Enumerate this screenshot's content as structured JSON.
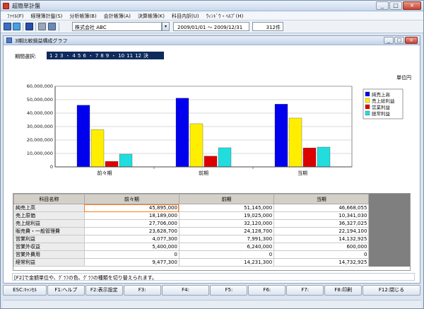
{
  "window": {
    "title": "超簡単計盤",
    "buttons": [
      "_",
      "□",
      "×"
    ]
  },
  "menu": {
    "items": [
      "ﾌｧｲﾙ(F)",
      "経理簿計盤(S)",
      "分析帳簿(B)",
      "会計帳簿(A)",
      "決算帳簿(K)",
      "科目内訳(U)",
      "ｳｨﾝﾄﾞｳ・ﾍﾙﾌﾟ(H)"
    ]
  },
  "toolbar": {
    "company": "株式会社 ABC",
    "period": "2009/01/01 〜 2009/12/31",
    "count": "312件",
    "dropdown_glyph": "▾"
  },
  "child_window": {
    "title": "3期比較損益構成グラフ",
    "buttons": [
      "_",
      "□",
      "×"
    ]
  },
  "period_select": {
    "label": "期間選択:",
    "months": [
      "1",
      "2",
      "3",
      "・",
      "4",
      "5",
      "6",
      "・",
      "7",
      "8",
      "9",
      "・",
      "10",
      "11",
      "12",
      "決"
    ]
  },
  "unit_label": "単位円",
  "chart_data": {
    "type": "bar",
    "categories": [
      "前々期",
      "前期",
      "当期"
    ],
    "series": [
      {
        "name": "純売上高",
        "color": "#0000ee",
        "values": [
          45895000,
          51145000,
          46668055
        ]
      },
      {
        "name": "売上総利益",
        "color": "#ffee00",
        "values": [
          27706000,
          32120000,
          36327025
        ]
      },
      {
        "name": "営業利益",
        "color": "#dd0000",
        "values": [
          4077300,
          7991300,
          14132925
        ]
      },
      {
        "name": "経常利益",
        "color": "#22dddd",
        "values": [
          9477300,
          14231300,
          14732925
        ]
      }
    ],
    "ylim": [
      0,
      60000000
    ],
    "yticks": [
      "0",
      "10,000,000",
      "20,000,000",
      "30,000,000",
      "40,000,000",
      "50,000,000",
      "60,000,000"
    ],
    "legend": "right",
    "grid": true
  },
  "table": {
    "headers": [
      "科目名称",
      "前々期",
      "前期",
      "当期"
    ],
    "rows": [
      [
        "純売上高",
        "45,895,000",
        "51,145,000",
        "46,668,055"
      ],
      [
        "売上原価",
        "18,189,000",
        "19,025,000",
        "10,341,030"
      ],
      [
        "売上総利益",
        "27,706,000",
        "32,120,000",
        "36,327,025"
      ],
      [
        "販売費・一般管理費",
        "23,628,700",
        "24,128,700",
        "22,194,100"
      ],
      [
        "営業利益",
        "4,077,300",
        "7,991,300",
        "14,132,925"
      ],
      [
        "営業外収益",
        "5,400,000",
        "6,240,000",
        "600,000"
      ],
      [
        "営業外費用",
        "0",
        "0",
        "0"
      ],
      [
        "経常利益",
        "9,477,300",
        "14,231,300",
        "14,732,925"
      ]
    ]
  },
  "status_text": "[F2]で金額単位や、ｸﾞﾗﾌの色、ｸﾞﾗﾌの種類を切り替えられます。",
  "fkeys": [
    "ESC:ｷｬﾝｾﾙ",
    "F1:ヘルプ",
    "F2:表示設定",
    "F3:",
    "F4:",
    "F5:",
    "F6:",
    "F7:",
    "F8:印刷",
    "F12:閉じる"
  ]
}
